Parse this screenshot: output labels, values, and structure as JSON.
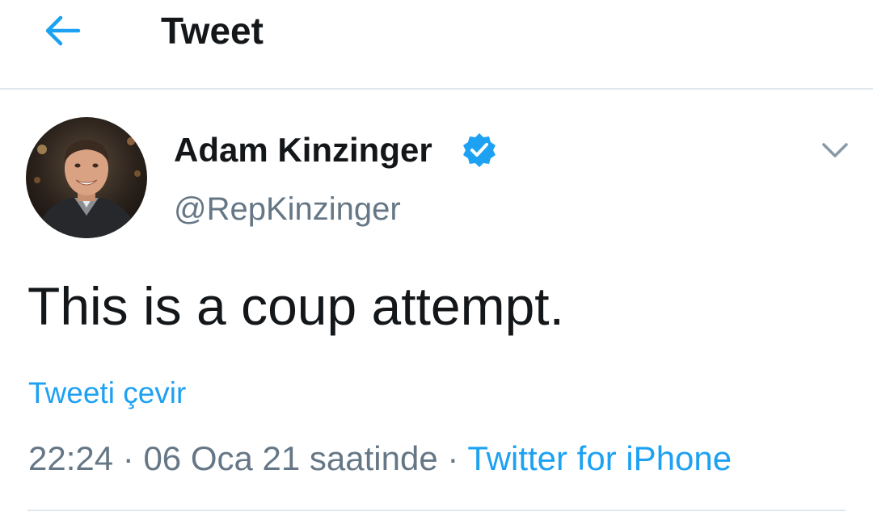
{
  "header": {
    "back_icon": "arrow-left-icon",
    "title": "Tweet"
  },
  "colors": {
    "accent": "#1da1f2",
    "text_primary": "#14171a",
    "text_secondary": "#657786",
    "divider": "#e1e8ed"
  },
  "tweet": {
    "author": {
      "display_name": "Adam Kinzinger",
      "verified_icon": "verified-badge-icon",
      "handle": "@RepKinzinger"
    },
    "menu_icon": "chevron-down-icon",
    "text": "This is a coup attempt.",
    "translate_label": "Tweeti çevir",
    "time": "22:24",
    "separator": "·",
    "date": "06 Oca 21 saatinde",
    "source": "Twitter for iPhone"
  }
}
